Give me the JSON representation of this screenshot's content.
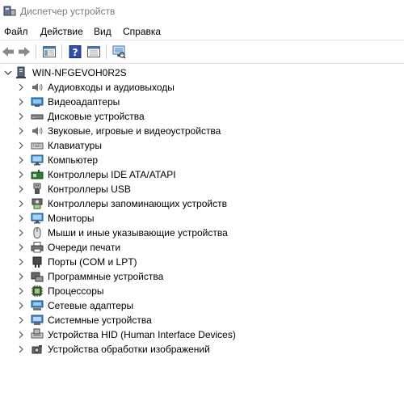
{
  "window": {
    "title": "Диспетчер устройств",
    "icon": "device-manager-icon"
  },
  "menu": [
    {
      "label": "Файл"
    },
    {
      "label": "Действие"
    },
    {
      "label": "Вид"
    },
    {
      "label": "Справка"
    }
  ],
  "toolbar": {
    "buttons": [
      "back-arrow-icon",
      "forward-arrow-icon",
      "show-hide-console-tree-icon",
      "help-icon",
      "properties-icon",
      "scan-hardware-icon"
    ]
  },
  "tree": {
    "root": {
      "label": "WIN-NFGEVOH0R2S",
      "icon": "computer-icon",
      "expanded": true
    },
    "items": [
      {
        "label": "Аудиовходы и аудиовыходы",
        "icon": "speaker-icon"
      },
      {
        "label": "Видеоадаптеры",
        "icon": "display-adapter-icon"
      },
      {
        "label": "Дисковые устройства",
        "icon": "disk-drive-icon"
      },
      {
        "label": "Звуковые, игровые и видеоустройства",
        "icon": "speaker-icon"
      },
      {
        "label": "Клавиатуры",
        "icon": "keyboard-icon"
      },
      {
        "label": "Компьютер",
        "icon": "monitor-icon"
      },
      {
        "label": "Контроллеры IDE ATA/ATAPI",
        "icon": "ide-controller-icon"
      },
      {
        "label": "Контроллеры USB",
        "icon": "usb-icon"
      },
      {
        "label": "Контроллеры запоминающих устройств",
        "icon": "storage-controller-icon"
      },
      {
        "label": "Мониторы",
        "icon": "monitor-icon"
      },
      {
        "label": "Мыши и иные указывающие устройства",
        "icon": "mouse-icon"
      },
      {
        "label": "Очереди печати",
        "icon": "printer-icon"
      },
      {
        "label": "Порты (COM и LPT)",
        "icon": "port-icon"
      },
      {
        "label": "Программные устройства",
        "icon": "software-device-icon"
      },
      {
        "label": "Процессоры",
        "icon": "processor-icon"
      },
      {
        "label": "Сетевые адаптеры",
        "icon": "network-adapter-icon"
      },
      {
        "label": "Системные устройства",
        "icon": "system-device-icon"
      },
      {
        "label": "Устройства HID (Human Interface Devices)",
        "icon": "hid-icon"
      },
      {
        "label": "Устройства обработки изображений",
        "icon": "imaging-device-icon"
      }
    ]
  }
}
